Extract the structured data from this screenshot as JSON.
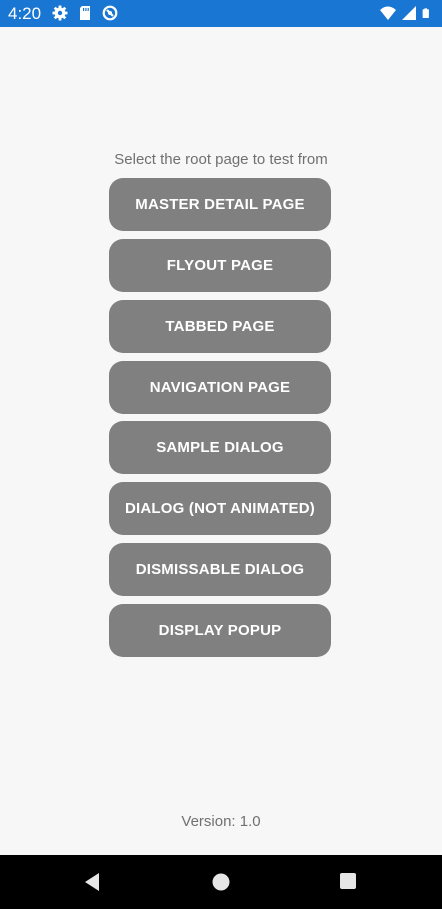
{
  "status_bar": {
    "time": "4:20",
    "left_icons": [
      "gear-icon",
      "sd-card-icon",
      "sync-icon"
    ],
    "right_icons": [
      "wifi-icon",
      "cellular-signal-icon",
      "battery-icon"
    ],
    "color": "#1976d2"
  },
  "main": {
    "prompt": "Select the root page to test from",
    "buttons": [
      {
        "label": "MASTER DETAIL PAGE"
      },
      {
        "label": "FLYOUT PAGE"
      },
      {
        "label": "TABBED PAGE"
      },
      {
        "label": "NAVIGATION PAGE"
      },
      {
        "label": "SAMPLE DIALOG"
      },
      {
        "label": "DIALOG (NOT ANIMATED)"
      },
      {
        "label": "DISMISSABLE DIALOG"
      },
      {
        "label": "DISPLAY POPUP"
      }
    ],
    "button_color": "#808080"
  },
  "footer": {
    "version": "Version: 1.0"
  },
  "nav_bar": {
    "icons": [
      "back-icon",
      "home-icon",
      "recents-icon"
    ]
  }
}
